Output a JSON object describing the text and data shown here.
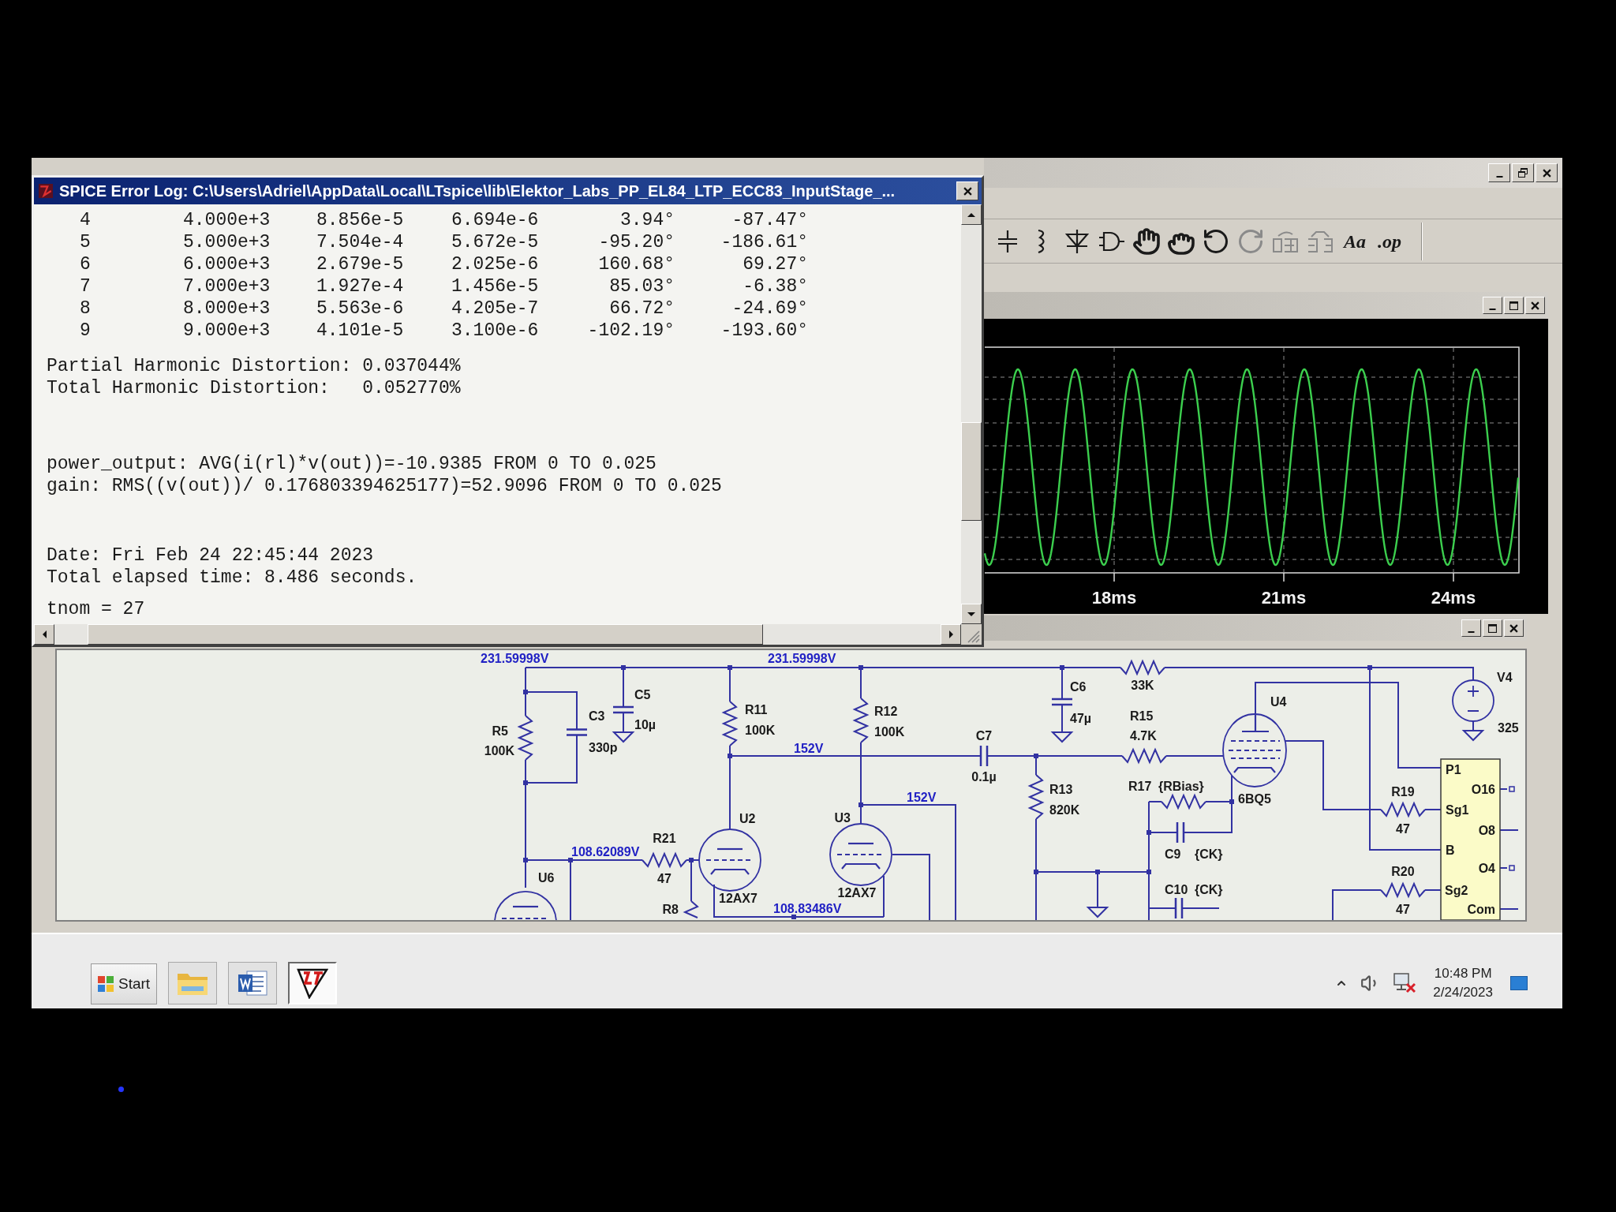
{
  "error_log": {
    "title": "SPICE Error Log: C:\\Users\\Adriel\\AppData\\Local\\LTspice\\lib\\Elektor_Labs_PP_EL84_LTP_ECC83_InputStage_...",
    "harmonics": [
      [
        "4",
        "4.000e+3",
        "8.856e-5",
        "6.694e-6",
        "3.94°",
        "-87.47°"
      ],
      [
        "5",
        "5.000e+3",
        "7.504e-4",
        "5.672e-5",
        "-95.20°",
        "-186.61°"
      ],
      [
        "6",
        "6.000e+3",
        "2.679e-5",
        "2.025e-6",
        "160.68°",
        "69.27°"
      ],
      [
        "7",
        "7.000e+3",
        "1.927e-4",
        "1.456e-5",
        "85.03°",
        "-6.38°"
      ],
      [
        "8",
        "8.000e+3",
        "5.563e-6",
        "4.205e-7",
        "66.72°",
        "-24.69°"
      ],
      [
        "9",
        "9.000e+3",
        "4.101e-5",
        "3.100e-6",
        "-102.19°",
        "-193.60°"
      ]
    ],
    "distortion": [
      "Partial Harmonic Distortion: 0.037044%",
      "Total Harmonic Distortion:   0.052770%"
    ],
    "measurements": [
      "power_output: AVG(i(rl)*v(out))=-10.9385 FROM 0 TO 0.025",
      "gain: RMS((v(out))/ 0.176803394625177)=52.9096 FROM 0 TO 0.025"
    ],
    "run_info": [
      "Date: Fri Feb 24 22:45:44 2023",
      "Total elapsed time: 8.486 seconds."
    ],
    "last_line": "tnom = 27"
  },
  "toolbar": {
    "text_tools": [
      "Aa",
      ".op"
    ]
  },
  "waveform": {
    "x_tick_labels": [
      "18ms",
      "21ms",
      "24ms"
    ]
  },
  "schematic": {
    "net_labels": [
      "231.59998V",
      "231.59998V",
      "152V",
      "152V",
      "108.62089V",
      "108.83486V"
    ],
    "components": [
      {
        "kind": "resistor",
        "name": "R5",
        "value": "100K"
      },
      {
        "kind": "capacitor",
        "name": "C3",
        "value": "330p"
      },
      {
        "kind": "capacitor",
        "name": "C5",
        "value": "10µ"
      },
      {
        "kind": "resistor",
        "name": "R11",
        "value": "100K"
      },
      {
        "kind": "resistor",
        "name": "R12",
        "value": "100K"
      },
      {
        "kind": "capacitor",
        "name": "C7",
        "value": "0.1µ"
      },
      {
        "kind": "capacitor",
        "name": "C6",
        "value": "47µ"
      },
      {
        "kind": "resistor",
        "value": "33K"
      },
      {
        "kind": "resistor",
        "name": "R15",
        "value": "4.7K"
      },
      {
        "kind": "resistor",
        "name": "R13",
        "value": "820K"
      },
      {
        "kind": "tube",
        "name": "U4",
        "value": "6BQ5"
      },
      {
        "kind": "resistor",
        "name": "R17",
        "value": "{RBias}"
      },
      {
        "kind": "capacitor",
        "name": "C9",
        "value": "{CK}"
      },
      {
        "kind": "capacitor",
        "name": "C10",
        "value": "{CK}"
      },
      {
        "kind": "resistor",
        "name": "R19",
        "value": "47"
      },
      {
        "kind": "resistor",
        "name": "R20",
        "value": "47"
      },
      {
        "kind": "voltage_source",
        "name": "V4",
        "value": "325"
      },
      {
        "kind": "tube",
        "name": "U2",
        "value": "12AX7"
      },
      {
        "kind": "tube",
        "name": "U3",
        "value": "12AX7"
      },
      {
        "kind": "tube",
        "name": "U6"
      },
      {
        "kind": "resistor",
        "name": "R21",
        "value": "47"
      },
      {
        "kind": "resistor",
        "name": "R8"
      },
      {
        "kind": "transformer",
        "pins": [
          "P1",
          "O16",
          "Sg1",
          "O8",
          "B",
          "O4",
          "Sg2",
          "Com"
        ]
      }
    ]
  },
  "taskbar": {
    "start": "Start",
    "buttons": [
      {
        "kind": "folder",
        "selected": false
      },
      {
        "kind": "word",
        "selected": false
      },
      {
        "kind": "ltspice",
        "selected": true
      }
    ],
    "clock": {
      "time": "10:48 PM",
      "date": "2/24/2023"
    }
  }
}
